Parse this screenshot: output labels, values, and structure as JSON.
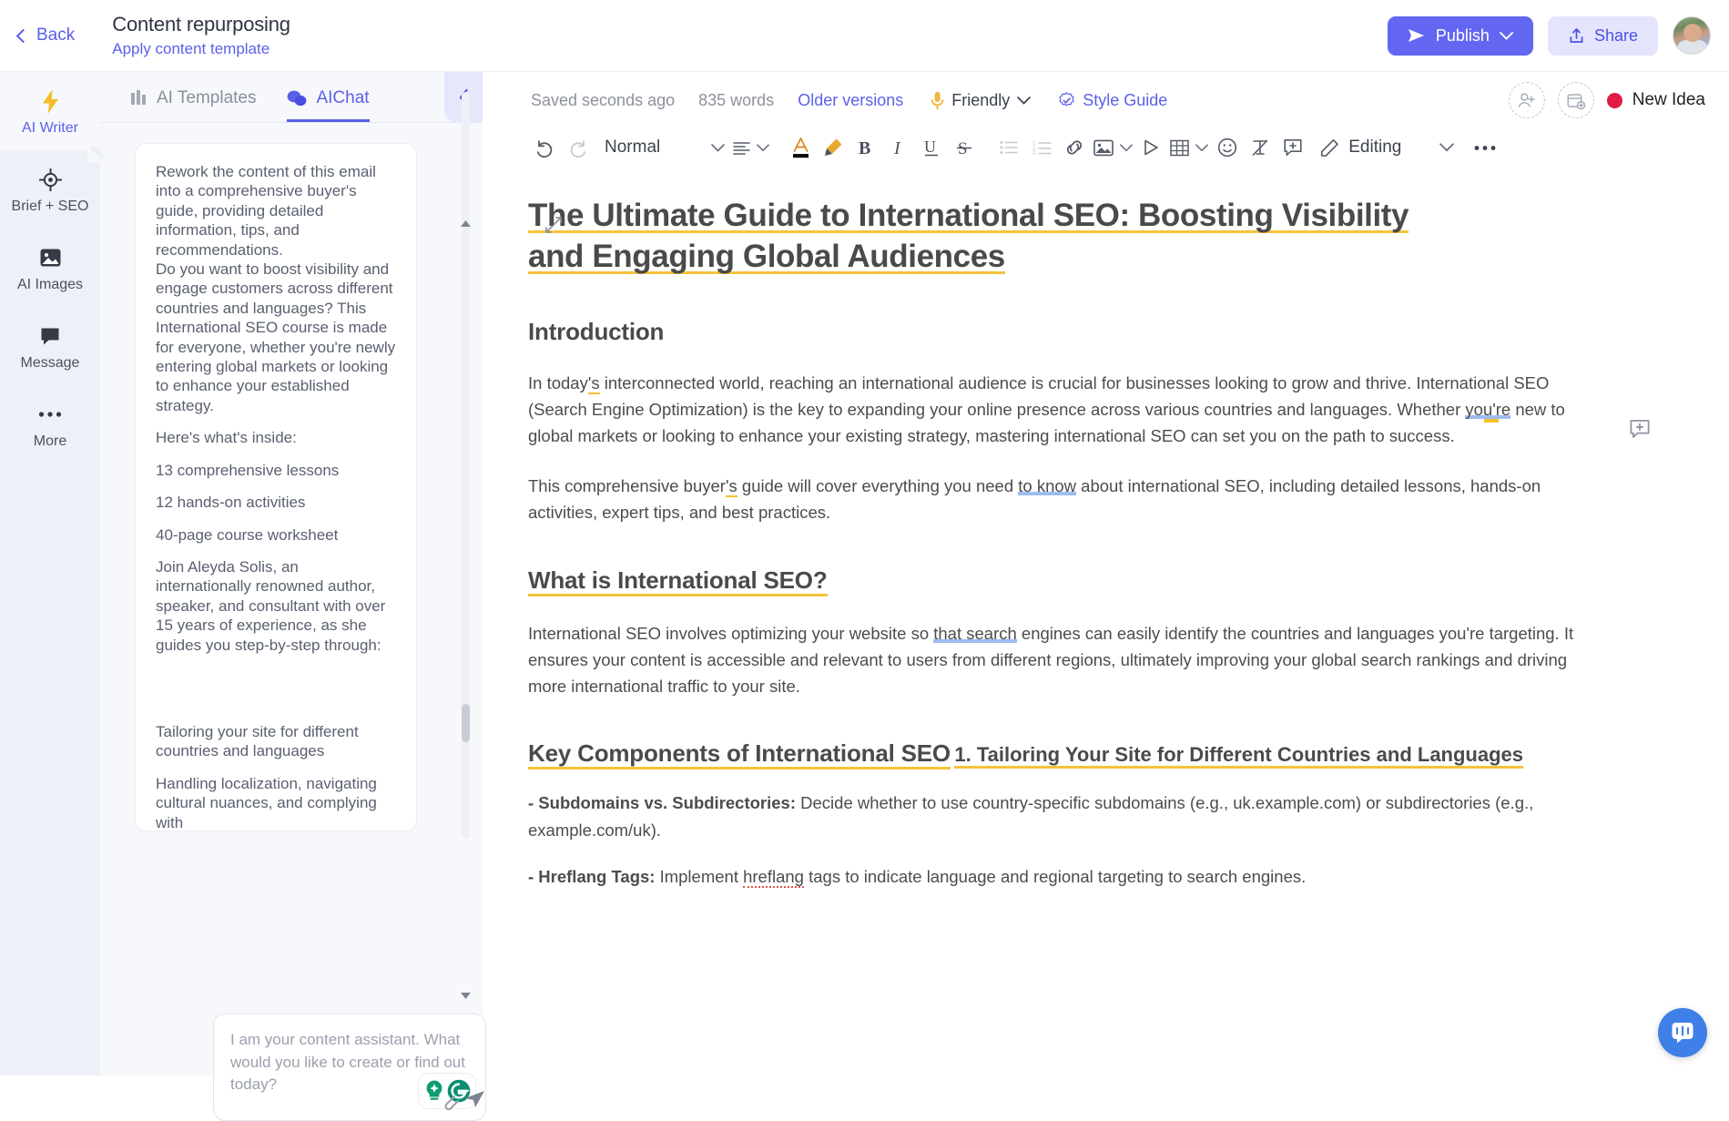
{
  "topbar": {
    "back_label": "Back",
    "doc_title": "Content repurposing",
    "doc_subtitle": "Apply content template",
    "publish_label": "Publish",
    "share_label": "Share",
    "accent_color": "#6366f1"
  },
  "rail": {
    "items": [
      {
        "label": "AI Writer",
        "icon": "lightning-icon",
        "active": true
      },
      {
        "label": "Brief + SEO",
        "icon": "target-icon",
        "active": false
      },
      {
        "label": "AI Images",
        "icon": "image-icon",
        "active": false
      },
      {
        "label": "Message",
        "icon": "chat-bubble-icon",
        "active": false
      },
      {
        "label": "More",
        "icon": "ellipsis-icon",
        "active": false
      }
    ]
  },
  "chat": {
    "tabs": [
      {
        "label": "AI Templates",
        "icon": "templates-icon",
        "active": false
      },
      {
        "label": "AIChat",
        "icon": "chat-icon",
        "active": true
      }
    ],
    "message_paragraphs": [
      "Rework the content of this email into a comprehensive buyer's guide, providing detailed information, tips, and recommendations.",
      "Do you want to boost visibility and engage customers across different countries and languages? This International SEO course is made for everyone, whether you're newly entering global markets or looking to enhance your established strategy.",
      "Here's what's inside:",
      "13 comprehensive lessons",
      "12 hands-on activities",
      "40-page course worksheet",
      "Join Aleyda Solis, an internationally renowned author, speaker, and consultant with over 15 years of experience, as she guides you step-by-step through:"
    ],
    "message_paragraphs_tail": [
      "Tailoring your site for different countries and languages",
      "Handling localization, navigating cultural nuances, and complying with"
    ],
    "input_placeholder": "I am your content assistant. What would you like to create or find out today?"
  },
  "editor": {
    "status": {
      "saved": "Saved seconds ago",
      "word_count": "835 words",
      "older_versions": "Older versions",
      "tone": "Friendly",
      "style_guide": "Style Guide",
      "idea_label": "New Idea",
      "idea_color": "#e01b45"
    },
    "toolbar": {
      "style_value": "Normal",
      "mode_value": "Editing",
      "items": [
        "undo-icon",
        "redo-icon",
        "paragraph-style-dropdown",
        "align-dropdown",
        "text-color-icon",
        "highlighter-icon",
        "bold-icon",
        "italic-icon",
        "underline-icon",
        "strikethrough-icon",
        "bullet-list-icon",
        "numbered-list-icon",
        "link-icon",
        "image-dropdown",
        "video-icon",
        "table-dropdown",
        "emoji-icon",
        "clear-formatting-icon",
        "add-comment-icon",
        "edit-mode-dropdown",
        "more-options-icon"
      ]
    },
    "document": {
      "title_line1": "The Ultimate Guide to International SEO: Boosting Visibility",
      "title_line2": "and Engaging Global Audiences",
      "h_introduction": "Introduction",
      "p1_a": "In today",
      "p1_b": "'s",
      "p1_c": " interconnected world, reaching an international audience is crucial for businesses looking to grow and thrive. International SEO (Search Engine Optimization) is the key to expanding your online presence across various countries and languages. ",
      "p1_d": "Whether ",
      "p1_e": "you're",
      "p1_f": " new to global markets or looking to enhance your existing strategy, mastering international SEO can set you on the path to success.",
      "p2_a": "This comprehensive buyer",
      "p2_b": "'s",
      "p2_c": " guide will cover everything you need ",
      "p2_d": "to know",
      "p2_e": " about international SEO, including detailed lessons, hands-on activities, expert tips, and best practices.",
      "h_what_is": "What is International SEO?",
      "p3_a": "International SEO involves optimizing your website so ",
      "p3_b": "that search",
      "p3_c": " engines can easily identify the countries and languages you're targeting. It ensures your content is accessible and relevant to users from different regions, ultimately improving your global search rankings and driving more international traffic to your site.",
      "h_key_components": "Key Components of International SEO",
      "h_sub1": "1. Tailoring Your Site for Different Countries and Languages",
      "li1_label": "- Subdomains vs. Subdirectories:",
      "li1_text": " Decide whether to use country-specific subdomains (e.g., uk.example.com) or subdirectories (e.g., example.com/uk).",
      "li2_label": "- Hreflang Tags:",
      "li2_text_a": " Implement ",
      "li2_text_b": "hreflang",
      "li2_text_c": " tags to indicate language and regional targeting to search engines."
    }
  }
}
